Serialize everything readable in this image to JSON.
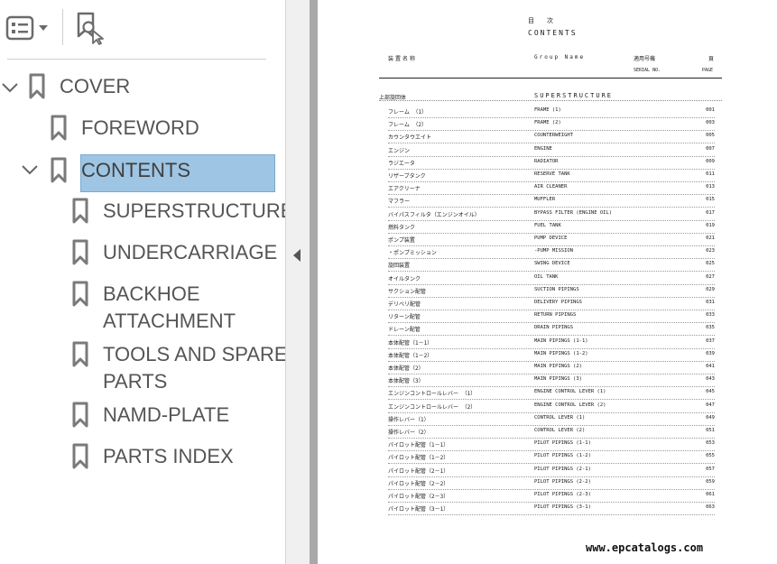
{
  "sidebar": {
    "toolbar": {
      "options_icon": "list-options-icon",
      "find_icon": "find-bookmark-icon"
    },
    "bookmarks": [
      {
        "label": "COVER"
      },
      {
        "label": "FOREWORD"
      },
      {
        "label": "CONTENTS"
      },
      {
        "label": "SUPERSTRUCTURE"
      },
      {
        "label": "UNDERCARRIAGE"
      },
      {
        "label": "BACKHOE",
        "label2": "ATTACHMENT"
      },
      {
        "label": "TOOLS AND SPARE",
        "label2": "PARTS"
      },
      {
        "label": "NAMD-PLATE"
      },
      {
        "label": "PARTS INDEX"
      }
    ]
  },
  "document": {
    "title_jp": "目次",
    "title_en": "CONTENTS",
    "header": {
      "col1": "装置名称",
      "col2": "Group Name",
      "col3": "適用号機",
      "col3_sub": "SERIAL NO.",
      "col4": "頁",
      "col4_sub": "PAGE"
    },
    "section": {
      "jp": "上部旋回体",
      "en": "SUPERSTRUCTURE"
    },
    "rows": [
      {
        "jp": "フレーム （1）",
        "en": "FRAME (1)",
        "page": "001"
      },
      {
        "jp": "フレーム （2）",
        "en": "FRAME (2)",
        "page": "003"
      },
      {
        "jp": "カウンタウエイト",
        "en": "COUNTERWEIGHT",
        "page": "005"
      },
      {
        "jp": "エンジン",
        "en": "ENGINE",
        "page": "007"
      },
      {
        "jp": "ラジエータ",
        "en": "RADIATOR",
        "page": "009"
      },
      {
        "jp": "リザーブタンク",
        "en": "RESERVE TANK",
        "page": "011"
      },
      {
        "jp": "エアクリーナ",
        "en": "AIR CLEANER",
        "page": "013"
      },
      {
        "jp": "マフラー",
        "en": "MUFFLER",
        "page": "015"
      },
      {
        "jp": "バイパスフィルタ（エンジンオイル）",
        "en": "BYPASS FILTER (ENGINE OIL)",
        "page": "017"
      },
      {
        "jp": "燃料タンク",
        "en": "FUEL TANK",
        "page": "019"
      },
      {
        "jp": "ポンプ装置",
        "en": "PUMP DEVICE",
        "page": "021"
      },
      {
        "jp": "・ポンプミッション",
        "en": "-PUMP MISSION",
        "page": "023"
      },
      {
        "jp": "旋回装置",
        "en": "SWING DEVICE",
        "page": "025"
      },
      {
        "jp": "オイルタンク",
        "en": "OIL TANK",
        "page": "027"
      },
      {
        "jp": "サクション配管",
        "en": "SUCTION PIPINGS",
        "page": "029"
      },
      {
        "jp": "デリベリ配管",
        "en": "DELIVERY PIPINGS",
        "page": "031"
      },
      {
        "jp": "リターン配管",
        "en": "RETURN PIPINGS",
        "page": "033"
      },
      {
        "jp": "ドレーン配管",
        "en": "DRAIN PIPINGS",
        "page": "035"
      },
      {
        "jp": "本体配管（1－1）",
        "en": "MAIN PIPINGS (1-1)",
        "page": "037"
      },
      {
        "jp": "本体配管（1－2）",
        "en": "MAIN PIPINGS (1-2)",
        "page": "039"
      },
      {
        "jp": "本体配管（2）",
        "en": "MAIN PIPINGS (2)",
        "page": "041"
      },
      {
        "jp": "本体配管（3）",
        "en": "MAIN PIPINGS (3)",
        "page": "043"
      },
      {
        "jp": "エンジンコントロールレバー （1）",
        "en": "ENGINE CONTROL LEVER (1)",
        "page": "045"
      },
      {
        "jp": "エンジンコントロールレバー （2）",
        "en": "ENGINE CONTROL LEVER (2)",
        "page": "047"
      },
      {
        "jp": "操作レバー（1）",
        "en": "CONTROL LEVER (1)",
        "page": "049"
      },
      {
        "jp": "操作レバー（2）",
        "en": "CONTROL LEVER (2)",
        "page": "051"
      },
      {
        "jp": "パイロット配管（1－1）",
        "en": "PILOT PIPINGS (1-1)",
        "page": "053"
      },
      {
        "jp": "パイロット配管（1－2）",
        "en": "PILOT PIPINGS (1-2)",
        "page": "055"
      },
      {
        "jp": "パイロット配管（2－1）",
        "en": "PILOT PIPINGS (2-1)",
        "page": "057"
      },
      {
        "jp": "パイロット配管（2－2）",
        "en": "PILOT PIPINGS (2-2)",
        "page": "059"
      },
      {
        "jp": "パイロット配管（2－3）",
        "en": "PILOT PIPINGS (2-3)",
        "page": "061"
      },
      {
        "jp": "パイロット配管（3－1）",
        "en": "PILOT PIPINGS (3-1)",
        "page": "063"
      }
    ]
  },
  "watermark": "www.epcatalogs.com",
  "colors": {
    "selection": "#9ec5e3",
    "label": "#555555",
    "icon": "#7a7a7a"
  }
}
